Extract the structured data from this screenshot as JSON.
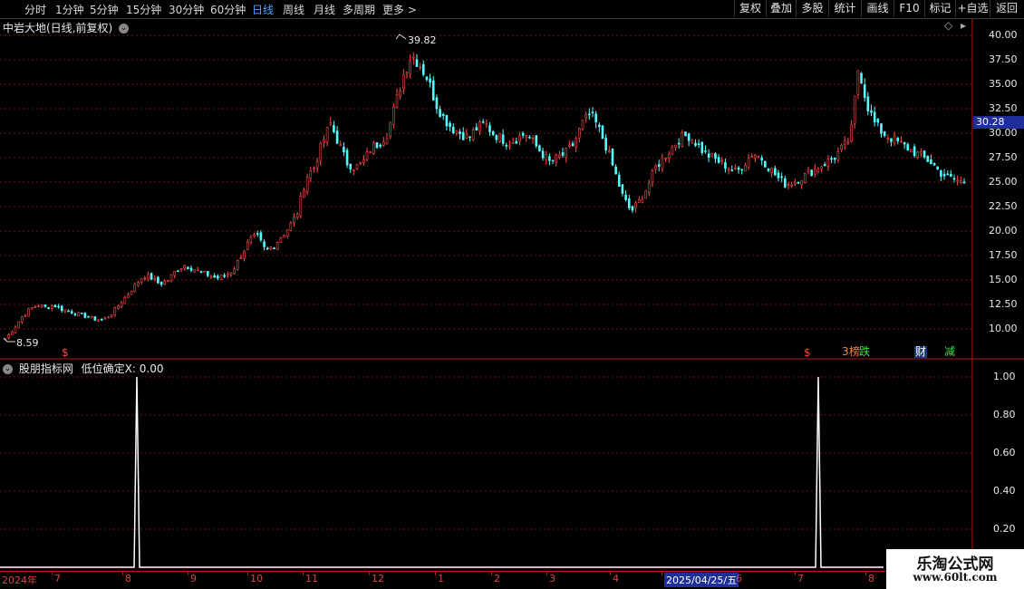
{
  "toolbar": {
    "periods": [
      "分时",
      "1分钟",
      "5分钟",
      "15分钟",
      "30分钟",
      "60分钟",
      "日线",
      "周线",
      "月线",
      "多周期"
    ],
    "active_period": "日线",
    "more_label": "更多",
    "right_buttons": [
      "复权",
      "叠加",
      "多股",
      "统计",
      "画线",
      "F10",
      "标记",
      "+自选",
      "返回"
    ]
  },
  "main_chart": {
    "title": "中岩大地(日线,前复权)",
    "high_label": "39.82",
    "low_label": "8.59",
    "current_price": "30.28",
    "y_ticks": [
      "40.00",
      "37.50",
      "35.00",
      "32.50",
      "30.00",
      "27.50",
      "25.00",
      "22.50",
      "20.00",
      "17.50",
      "15.00",
      "12.50",
      "10.00"
    ],
    "badges": [
      {
        "text": "$",
        "color": "#ff4040"
      },
      {
        "text": "$",
        "color": "#ff4040"
      },
      {
        "text": "3",
        "color": "#ff8040"
      },
      {
        "text": "榜",
        "color": "#ff8040"
      },
      {
        "text": "跌",
        "color": "#40e040"
      },
      {
        "text": "财",
        "color": "#4aa8ff"
      },
      {
        "text": "减",
        "color": "#40e040"
      }
    ]
  },
  "indicator": {
    "name": "股朋指标网",
    "value_label": "低位确定X: 0.00",
    "y_ticks": [
      "1.00",
      "0.80",
      "0.60",
      "0.40",
      "0.20"
    ]
  },
  "x_axis": {
    "labels": [
      "2024年",
      "7",
      "8",
      "9",
      "10",
      "11",
      "12",
      "1",
      "2",
      "3",
      "4",
      "2025/04/25/五",
      "6",
      "7",
      "8"
    ]
  },
  "watermark": {
    "line1": "乐淘公式网",
    "line2": "www.60lt.com"
  },
  "colors": {
    "up": "#ff4a4a",
    "down": "#54ffff",
    "grid": "#7a1010",
    "axis": "#b01818",
    "bg": "#000000",
    "highlight_bg": "#1e2f9c"
  },
  "chart_data": {
    "type": "candlestick",
    "title": "中岩大地(日线,前复权)",
    "ylim": [
      8.0,
      40.5
    ],
    "y_ticks": [
      40.0,
      37.5,
      35.0,
      32.5,
      30.0,
      27.5,
      25.0,
      22.5,
      20.0,
      17.5,
      15.0,
      12.5,
      10.0
    ],
    "x_labels": [
      "2024年",
      "7",
      "8",
      "9",
      "10",
      "11",
      "12",
      "1",
      "2",
      "3",
      "4",
      "2025/04/25/五",
      "6",
      "7",
      "8"
    ],
    "close_path": [
      9.0,
      10.0,
      11.2,
      12.0,
      12.5,
      12.2,
      12.4,
      12.0,
      11.8,
      11.5,
      11.3,
      11.0,
      10.9,
      11.5,
      12.5,
      13.5,
      14.5,
      15.5,
      15.2,
      14.6,
      15.0,
      16.0,
      16.5,
      16.2,
      15.8,
      15.5,
      15.2,
      15.4,
      16.0,
      17.5,
      19.0,
      19.5,
      18.0,
      18.5,
      19.5,
      20.5,
      22.0,
      25.5,
      26.5,
      29.0,
      31.0,
      29.0,
      27.0,
      26.5,
      27.0,
      28.5,
      29.0,
      30.0,
      33.0,
      36.0,
      38.0,
      37.0,
      35.5,
      33.0,
      31.5,
      30.5,
      30.0,
      29.5,
      30.5,
      31.0,
      30.0,
      29.5,
      29.0,
      29.5,
      30.0,
      29.0,
      28.0,
      27.0,
      27.5,
      28.0,
      29.0,
      31.0,
      32.0,
      30.5,
      28.5,
      26.0,
      23.5,
      22.0,
      23.0,
      24.5,
      26.5,
      27.5,
      28.5,
      29.5,
      29.8,
      29.0,
      28.0,
      27.5,
      27.0,
      26.5,
      26.0,
      27.0,
      28.0,
      27.5,
      26.5,
      25.5,
      24.8,
      25.0,
      25.5,
      26.0,
      26.5,
      27.0,
      27.5,
      28.5,
      29.5,
      37.0,
      33.0,
      31.0,
      30.0,
      29.5,
      29.0,
      28.5,
      28.0,
      27.5,
      27.0,
      26.0,
      25.5,
      25.2,
      25.0
    ],
    "high": 39.82,
    "low": 8.59,
    "current": 30.28
  },
  "indicator_data": {
    "type": "line",
    "name": "股朋指标网",
    "series_label": "低位确定X",
    "ylim": [
      0,
      1.0
    ],
    "spikes_at_month": [
      "8",
      "7"
    ],
    "spike_value": 1.0,
    "baseline": 0.0
  }
}
